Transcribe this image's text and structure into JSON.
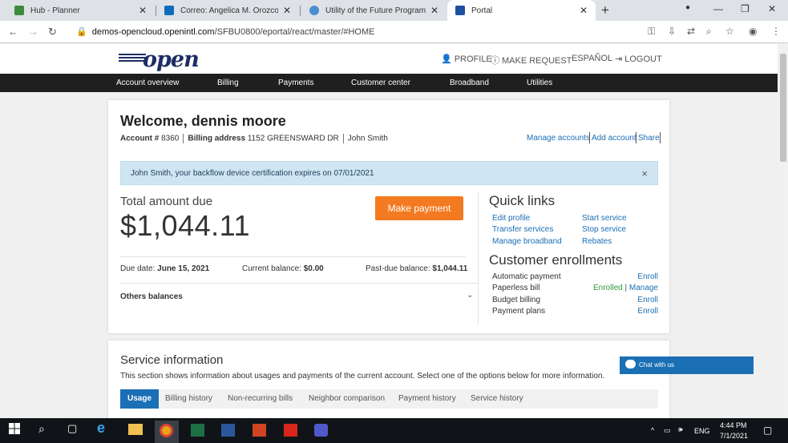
{
  "browser": {
    "tabs": [
      {
        "title": "Hub - Planner",
        "color": "#3a8b3a"
      },
      {
        "title": "Correo: Angelica M. Orozco O. -",
        "color": "#0f6cbd"
      },
      {
        "title": "Utility of the Future Program",
        "color": "#4b8fd1"
      },
      {
        "title": "Portal",
        "color": "#1e4fa0"
      }
    ],
    "url_host": "demos-opencloud.openintl.com",
    "url_path": "/SFBU0800/eportal/react/master/#HOME"
  },
  "header": {
    "logo": "open",
    "nav": [
      {
        "icon": "user-icon",
        "label": "PROFILE"
      },
      {
        "icon": "info-icon",
        "label": "MAKE REQUEST"
      },
      {
        "icon": "",
        "label": "ESPAÑOL"
      },
      {
        "icon": "logout-icon",
        "label": "LOGOUT"
      }
    ]
  },
  "main_nav": [
    "Account overview",
    "Billing",
    "Payments",
    "Customer center",
    "Broadband",
    "Utilities"
  ],
  "account": {
    "welcome": "Welcome, dennis moore",
    "account_label": "Account #",
    "account_number": "8360",
    "billing_label": "Billing address",
    "billing_address": "1152 GREENSWARD DR",
    "name": "John Smith",
    "links": [
      "Manage accounts",
      "Add account",
      "Share"
    ]
  },
  "alert": {
    "message": "John Smith, your backflow device certification expires on 07/01/2021",
    "close": "×"
  },
  "billing": {
    "total_label": "Total amount due",
    "total_amount": "$1,044.11",
    "pay_button": "Make payment",
    "due_label": "Due date:",
    "due_date": "June 15, 2021",
    "current_label": "Current balance:",
    "current_balance": "$0.00",
    "pastdue_label": "Past-due balance:",
    "pastdue_balance": "$1,044.11",
    "others": "Others balances"
  },
  "quick_links": {
    "title": "Quick links",
    "left": [
      "Edit profile",
      "Transfer services",
      "Manage broadband"
    ],
    "right": [
      "Start service",
      "Stop service",
      "Rebates"
    ]
  },
  "enrollments": {
    "title": "Customer enrollments",
    "items": [
      {
        "label": "Automatic payment",
        "action": "Enroll",
        "status": ""
      },
      {
        "label": "Paperless bill",
        "action": "Manage",
        "status": "Enrolled"
      },
      {
        "label": "Budget billing",
        "action": "Enroll",
        "status": ""
      },
      {
        "label": "Payment plans",
        "action": "Enroll",
        "status": ""
      }
    ]
  },
  "service": {
    "title": "Service information",
    "description": "This section shows information about usages and payments of the current account. Select one of the options below for more information.",
    "tabs": [
      "Usage",
      "Billing history",
      "Non-recurring bills",
      "Neighbor comparison",
      "Payment history",
      "Service history"
    ],
    "active_tab": 0
  },
  "chat": {
    "label": "Chat with us"
  },
  "taskbar": {
    "time": "4:44 PM",
    "date": "7/1/2021",
    "lang": "ENG"
  },
  "colors": {
    "accent": "#1a6fb5",
    "button": "#f37a21",
    "nav": "#1f1f1f"
  }
}
